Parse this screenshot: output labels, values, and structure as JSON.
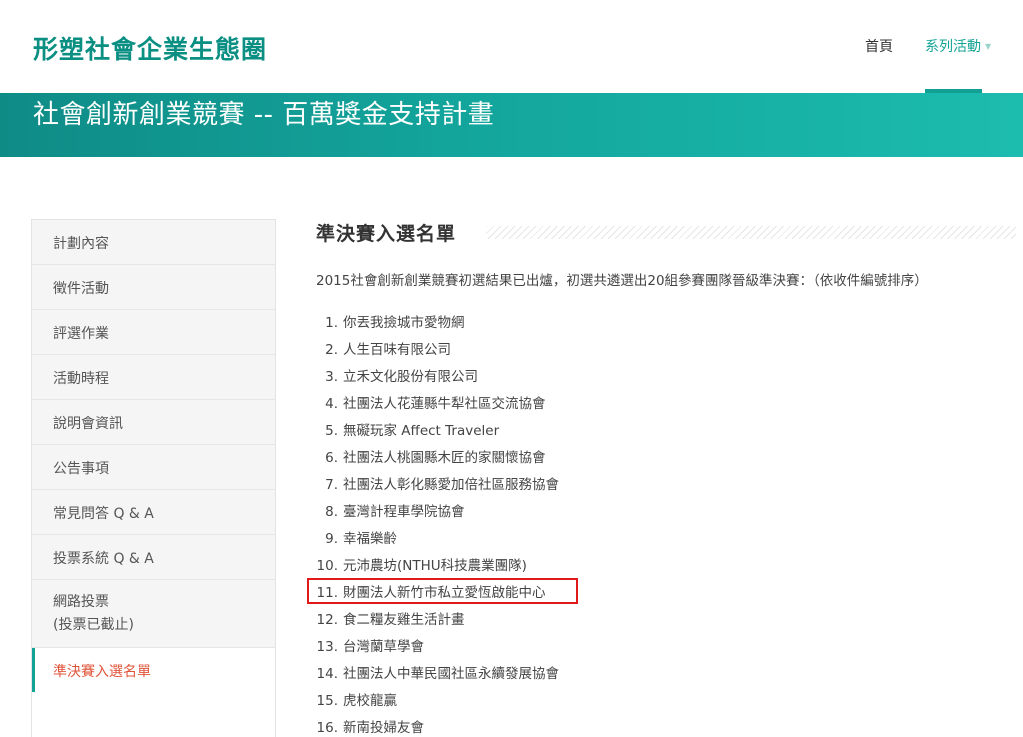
{
  "header": {
    "logo": "形塑社會企業生態圈",
    "nav": {
      "home": "首頁",
      "series": "系列活動",
      "series_caret": "▼"
    }
  },
  "banner": {
    "title": "社會創新創業競賽 -- 百萬獎金支持計畫"
  },
  "sidebar": {
    "items": [
      {
        "label": "計劃內容"
      },
      {
        "label": "徵件活動"
      },
      {
        "label": "評選作業"
      },
      {
        "label": "活動時程"
      },
      {
        "label": "說明會資訊"
      },
      {
        "label": "公告事項"
      },
      {
        "label": "常見問答 Q & A"
      },
      {
        "label": "投票系統 Q & A"
      },
      {
        "label": "網路投票",
        "sub": "(投票已截止)"
      },
      {
        "label": "準決賽入選名單",
        "active": true
      }
    ]
  },
  "main": {
    "title": "準決賽入選名單",
    "intro": "2015社會創新創業競賽初選結果已出爐，初選共遴選出20組參賽團隊晉級準決賽：（依收件編號排序）",
    "list": [
      {
        "num": "1.",
        "name": "你丟我撿城市愛物網"
      },
      {
        "num": "2.",
        "name": "人生百味有限公司"
      },
      {
        "num": "3.",
        "name": "立禾文化股份有限公司"
      },
      {
        "num": "4.",
        "name": "社團法人花蓮縣牛犁社區交流協會"
      },
      {
        "num": "5.",
        "name": "無礙玩家 Affect Traveler"
      },
      {
        "num": "6.",
        "name": "社團法人桃園縣木匠的家關懷協會"
      },
      {
        "num": "7.",
        "name": "社團法人彰化縣愛加倍社區服務協會"
      },
      {
        "num": "8.",
        "name": "臺灣計程車學院協會"
      },
      {
        "num": "9.",
        "name": "幸福樂齡"
      },
      {
        "num": "10.",
        "name": "元沛農坊(NTHU科技農業團隊)"
      },
      {
        "num": "11.",
        "name": "財團法人新竹市私立愛恆啟能中心",
        "highlighted": true
      },
      {
        "num": "12.",
        "name": "食二糧友雞生活計畫"
      },
      {
        "num": "13.",
        "name": "台灣蘭草學會"
      },
      {
        "num": "14.",
        "name": "社團法人中華民國社區永續發展協會"
      },
      {
        "num": "15.",
        "name": "虎校龍贏"
      },
      {
        "num": "16.",
        "name": "新南投婦友會"
      }
    ]
  },
  "colors": {
    "brand": "#0a8f82",
    "accent_text": "#e0543a",
    "highlight_box": "#e01a1a"
  }
}
